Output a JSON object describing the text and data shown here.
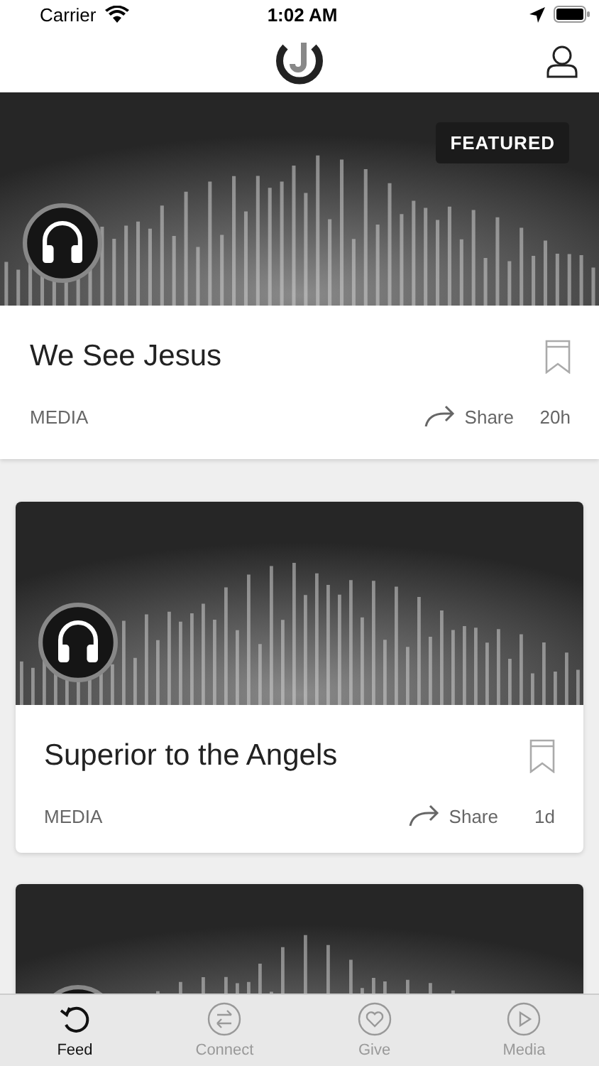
{
  "status_bar": {
    "carrier": "Carrier",
    "time": "1:02 AM"
  },
  "feed": [
    {
      "kind": "featured",
      "badge": "FEATURED",
      "title": "We See Jesus",
      "category": "MEDIA",
      "share": "Share",
      "age": "20h"
    },
    {
      "kind": "card",
      "title": "Superior to the Angels",
      "category": "MEDIA",
      "share": "Share",
      "age": "1d"
    },
    {
      "kind": "partial"
    }
  ],
  "tabs": [
    {
      "label": "Feed",
      "selected": true
    },
    {
      "label": "Connect",
      "selected": false
    },
    {
      "label": "Give",
      "selected": false
    },
    {
      "label": "Media",
      "selected": false
    }
  ]
}
